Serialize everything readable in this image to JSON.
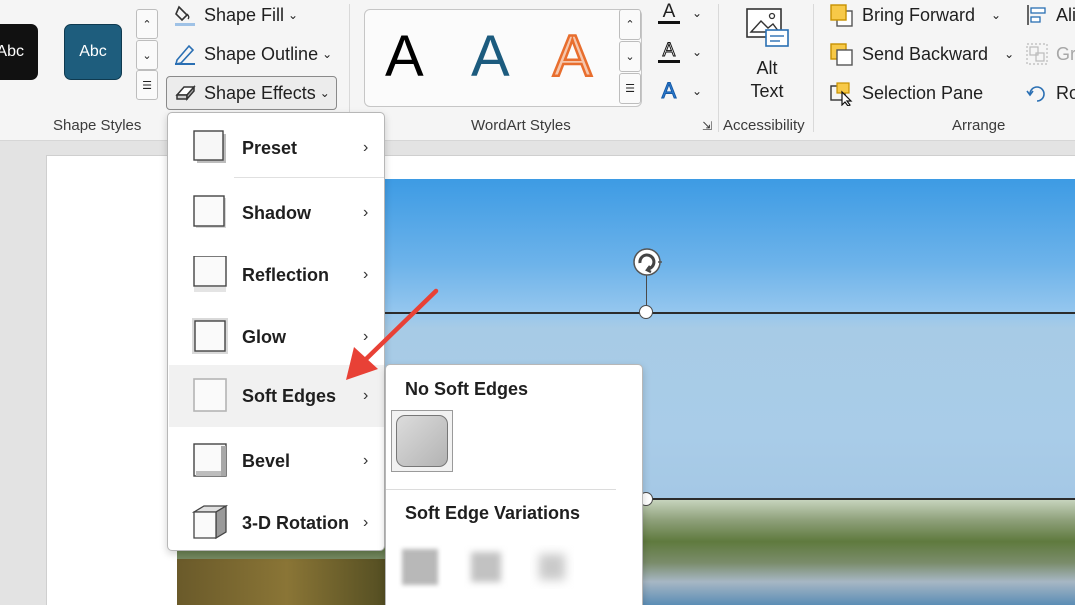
{
  "ribbon": {
    "shape_styles": {
      "group_label": "Shape Styles",
      "thumbs": [
        "Abc",
        "Abc"
      ],
      "shape_fill_label": "Shape Fill",
      "shape_outline_label": "Shape Outline",
      "shape_effects_label": "Shape Effects"
    },
    "wordart_styles": {
      "group_label": "WordArt Styles",
      "samples": [
        "A",
        "A",
        "A"
      ],
      "text_fill_glyph": "A",
      "text_outline_glyph": "A",
      "text_effects_glyph": "A"
    },
    "accessibility": {
      "group_label": "Accessibility",
      "alt_text_line1": "Alt",
      "alt_text_line2": "Text"
    },
    "arrange": {
      "group_label": "Arrange",
      "bring_forward_label": "Bring Forward",
      "send_backward_label": "Send Backward",
      "selection_pane_label": "Selection Pane",
      "align_label_partial": "Ali",
      "group_label_partial": "Gr",
      "rotate_label_partial": "Ro"
    }
  },
  "shape_effects_menu": {
    "items": [
      {
        "label": "Preset",
        "hover": false
      },
      {
        "label": "Shadow",
        "hover": false
      },
      {
        "label": "Reflection",
        "hover": false
      },
      {
        "label": "Glow",
        "hover": false
      },
      {
        "label": "Soft Edges",
        "hover": true
      },
      {
        "label": "Bevel",
        "hover": false
      },
      {
        "label": "3-D Rotation",
        "hover": false
      }
    ]
  },
  "soft_edges_submenu": {
    "no_soft_edges_heading": "No Soft Edges",
    "variations_heading": "Soft Edge Variations"
  },
  "colors": {
    "thumb_black": "#111111",
    "thumb_teal": "#1e5d7d",
    "wordart_blue": "#1c5b7e",
    "wordart_orange": "#e86e2e",
    "arrow_red": "#e84136"
  }
}
